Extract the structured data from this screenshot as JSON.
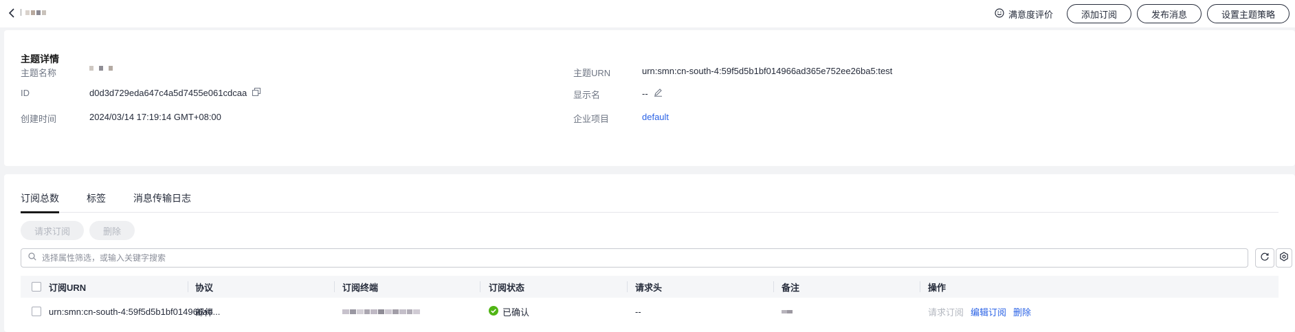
{
  "header": {
    "actions": {
      "satisfaction": "满意度评价",
      "add_subscription": "添加订阅",
      "publish_message": "发布消息",
      "set_policy": "设置主题策略"
    }
  },
  "detail": {
    "title": "主题详情",
    "labels": {
      "name": "主题名称",
      "id": "ID",
      "created": "创建时间",
      "urn": "主题URN",
      "display_name": "显示名",
      "enterprise_project": "企业项目"
    },
    "values": {
      "id": "d0d3d729eda647c4a5d7455e061cdcaa",
      "created": "2024/03/14 17:19:14 GMT+08:00",
      "urn": "urn:smn:cn-south-4:59f5d5b1bf014966ad365e752ee26ba5:test",
      "display_name": "--",
      "enterprise_project": "default"
    }
  },
  "subscriptions": {
    "tabs": [
      "订阅总数",
      "标签",
      "消息传输日志"
    ],
    "buttons": {
      "request": "请求订阅",
      "delete": "删除"
    },
    "search": {
      "placeholder": "选择属性筛选，或输入关键字搜索"
    },
    "columns": [
      "订阅URN",
      "协议",
      "订阅终端",
      "订阅状态",
      "请求头",
      "备注",
      "操作"
    ],
    "rows": [
      {
        "urn": "urn:smn:cn-south-4:59f5d5b1bf014966ad...",
        "protocol": "邮件",
        "status": "已确认",
        "headers": "--",
        "actions": {
          "request": "请求订阅",
          "edit": "编辑订阅",
          "delete": "删除"
        }
      }
    ]
  },
  "colors": {
    "link": "#2b63e6",
    "success": "#50b514",
    "disabled_text": "#b4b8c0"
  }
}
